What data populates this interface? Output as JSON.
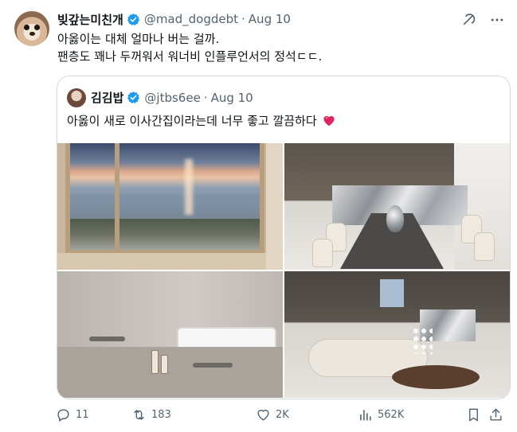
{
  "author": {
    "display_name": "빚갚는미친개",
    "handle": "@mad_dogdebt",
    "date": "Aug 10"
  },
  "tweet": {
    "line1": "아옳이는 대체 얼마나 버는 걸까.",
    "line2": "팬층도 꽤나 두꺼워서 워너비 인플루언서의 정석ㄷㄷ."
  },
  "quote": {
    "display_name": "김김밥",
    "handle": "@jtbs6ee",
    "date": "Aug 10",
    "text": "아옳이 새로 이사간집이라는데 너무 좋고 깔끔하다"
  },
  "actions": {
    "replies": "11",
    "retweets": "183",
    "likes": "2K",
    "views": "562K"
  },
  "colors": {
    "verified": "#1d9bf0",
    "muted_text": "#536471",
    "border": "#cfd9de",
    "emoji_heart": "#e0245e"
  },
  "icons": [
    "verified-badge-icon",
    "grok-icon",
    "more-icon",
    "sparkling-heart-icon",
    "reply-icon",
    "retweet-icon",
    "like-icon",
    "views-icon",
    "bookmark-icon",
    "share-icon"
  ]
}
